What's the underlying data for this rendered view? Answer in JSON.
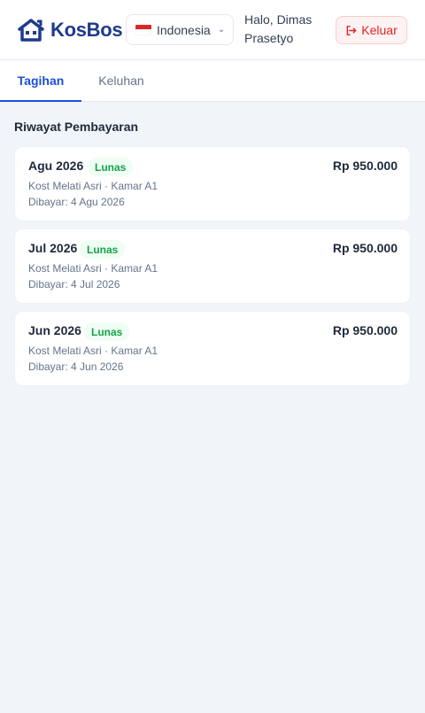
{
  "brand": {
    "name": "KosBos",
    "logo_color": "#1e3a8a"
  },
  "header": {
    "language": {
      "selected": "Indonesia",
      "flag": "indonesia-flag-icon"
    },
    "greeting": "Halo, Dimas Prasetyo",
    "logout_label": "Keluar",
    "logout_color": "#dc2626"
  },
  "tabs": [
    {
      "label": "Tagihan",
      "active": true
    },
    {
      "label": "Keluhan",
      "active": false
    }
  ],
  "section_title": "Riwayat Pembayaran",
  "payments": [
    {
      "period": "Agu 2026",
      "status": "Lunas",
      "amount": "Rp 950.000",
      "place": "Kost Melati Asri · Kamar A1",
      "paid": "Dibayar: 4 Agu 2026"
    },
    {
      "period": "Jul 2026",
      "status": "Lunas",
      "amount": "Rp 950.000",
      "place": "Kost Melati Asri · Kamar A1",
      "paid": "Dibayar: 4 Jul 2026"
    },
    {
      "period": "Jun 2026",
      "status": "Lunas",
      "amount": "Rp 950.000",
      "place": "Kost Melati Asri · Kamar A1",
      "paid": "Dibayar: 4 Jun 2026"
    }
  ],
  "colors": {
    "accent": "#1d4ed8",
    "success": "#16a34a",
    "background": "#f1f5f9"
  }
}
